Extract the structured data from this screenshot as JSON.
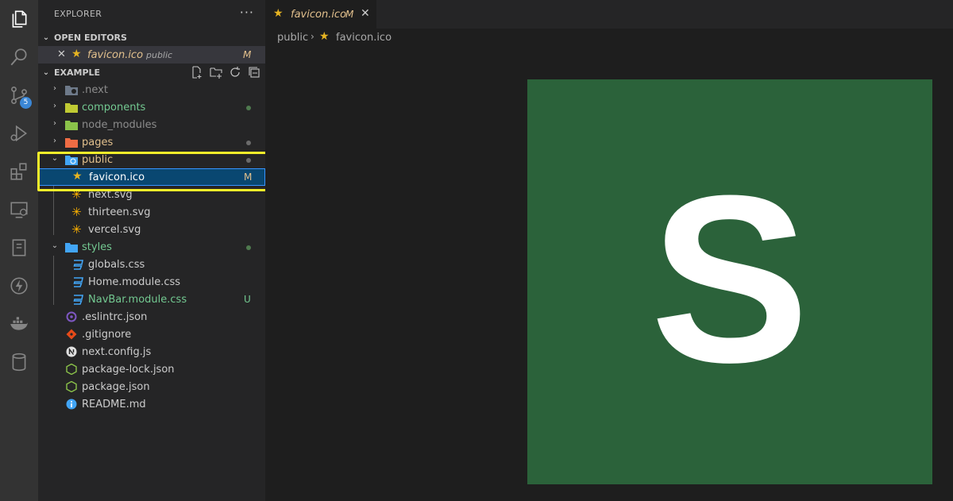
{
  "activity_bar": {
    "items": [
      "explorer-icon",
      "search-icon",
      "source-control-icon",
      "run-debug-icon",
      "extensions-icon",
      "remote-explorer-icon",
      "notebook-icon",
      "lightning-icon",
      "docker-icon",
      "database-icon"
    ],
    "scm_badge": "5"
  },
  "sidebar": {
    "title": "EXPLORER",
    "more": "···",
    "open_editors": {
      "label": "OPEN EDITORS",
      "file": "favicon.ico",
      "dir": "public",
      "status": "M"
    },
    "workspace": {
      "label": "EXAMPLE",
      "tree": [
        {
          "name": ".next",
          "kind": "folder",
          "icon": "next-folder-icon"
        },
        {
          "name": "components",
          "kind": "folder",
          "icon": "components-folder-icon",
          "status": "dot"
        },
        {
          "name": "node_modules",
          "kind": "folder",
          "icon": "node-folder-icon"
        },
        {
          "name": "pages",
          "kind": "folder",
          "icon": "pages-folder-icon",
          "status": "dot-grey"
        },
        {
          "name": "public",
          "kind": "folder-open",
          "icon": "public-folder-icon",
          "status": "dot-grey"
        },
        {
          "name": "favicon.ico",
          "kind": "file",
          "icon": "star-icon",
          "status": "M"
        },
        {
          "name": "next.svg",
          "kind": "file",
          "icon": "svg-file-icon"
        },
        {
          "name": "thirteen.svg",
          "kind": "file",
          "icon": "svg-file-icon"
        },
        {
          "name": "vercel.svg",
          "kind": "file",
          "icon": "svg-file-icon"
        },
        {
          "name": "styles",
          "kind": "folder-open",
          "icon": "styles-folder-icon",
          "status": "dot"
        },
        {
          "name": "globals.css",
          "kind": "file",
          "icon": "css-file-icon"
        },
        {
          "name": "Home.module.css",
          "kind": "file",
          "icon": "css-file-icon"
        },
        {
          "name": "NavBar.module.css",
          "kind": "file",
          "icon": "css-file-icon",
          "status": "U"
        },
        {
          "name": ".eslintrc.json",
          "kind": "file",
          "icon": "eslint-file-icon"
        },
        {
          "name": ".gitignore",
          "kind": "file",
          "icon": "git-file-icon"
        },
        {
          "name": "next.config.js",
          "kind": "file",
          "icon": "next-file-icon"
        },
        {
          "name": "package-lock.json",
          "kind": "file",
          "icon": "node-file-icon"
        },
        {
          "name": "package.json",
          "kind": "file",
          "icon": "node-file-icon"
        },
        {
          "name": "README.md",
          "kind": "file",
          "icon": "info-file-icon"
        }
      ]
    }
  },
  "editor": {
    "tab": {
      "name": "favicon.ico",
      "status": "M"
    },
    "breadcrumb": {
      "folder": "public",
      "file": "favicon.ico"
    },
    "preview": {
      "letter": "S",
      "bg_color": "#2b623a",
      "fg_color": "#ffffff"
    }
  },
  "colors": {
    "modified": "#e2c08d",
    "untracked": "#73c991",
    "highlight": "#f5ef2a",
    "selection": "#094771"
  }
}
